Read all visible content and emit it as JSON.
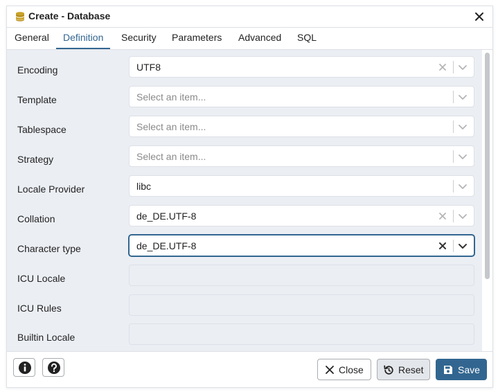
{
  "dialog": {
    "title": "Create - Database",
    "title_icon": "database-icon"
  },
  "tabs": [
    {
      "label": "General",
      "active": false
    },
    {
      "label": "Definition",
      "active": true
    },
    {
      "label": "Security",
      "active": false
    },
    {
      "label": "Parameters",
      "active": false
    },
    {
      "label": "Advanced",
      "active": false
    },
    {
      "label": "SQL",
      "active": false
    }
  ],
  "fields": [
    {
      "label": "Encoding",
      "value": "UTF8",
      "placeholder": "",
      "clearable": true,
      "focused": false,
      "disabled": false
    },
    {
      "label": "Template",
      "value": "",
      "placeholder": "Select an item...",
      "clearable": false,
      "focused": false,
      "disabled": false
    },
    {
      "label": "Tablespace",
      "value": "",
      "placeholder": "Select an item...",
      "clearable": false,
      "focused": false,
      "disabled": false
    },
    {
      "label": "Strategy",
      "value": "",
      "placeholder": "Select an item...",
      "clearable": false,
      "focused": false,
      "disabled": false
    },
    {
      "label": "Locale Provider",
      "value": "libc",
      "placeholder": "",
      "clearable": false,
      "focused": false,
      "disabled": false
    },
    {
      "label": "Collation",
      "value": "de_DE.UTF-8",
      "placeholder": "",
      "clearable": true,
      "focused": false,
      "disabled": false
    },
    {
      "label": "Character type",
      "value": "de_DE.UTF-8",
      "placeholder": "",
      "clearable": true,
      "focused": true,
      "disabled": false
    },
    {
      "label": "ICU Locale",
      "value": "",
      "placeholder": "",
      "clearable": false,
      "focused": false,
      "disabled": true
    },
    {
      "label": "ICU Rules",
      "value": "",
      "placeholder": "",
      "clearable": false,
      "focused": false,
      "disabled": true
    },
    {
      "label": "Builtin Locale",
      "value": "",
      "placeholder": "",
      "clearable": false,
      "focused": false,
      "disabled": true
    }
  ],
  "footer": {
    "info_icon": "info-icon",
    "help_icon": "help-icon",
    "close_label": "Close",
    "reset_label": "Reset",
    "save_label": "Save"
  },
  "colors": {
    "accent": "#326690",
    "form_background": "#ebeef3",
    "border": "#dde0e6"
  }
}
